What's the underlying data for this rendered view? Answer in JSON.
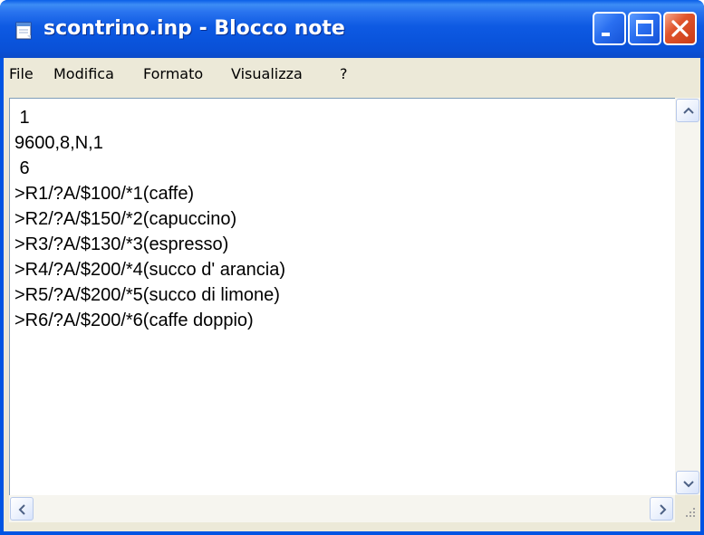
{
  "window": {
    "title": "scontrino.inp - Blocco note",
    "app_icon": "notepad-icon",
    "controls": {
      "minimize_icon": "minimize-icon",
      "maximize_icon": "maximize-icon",
      "close_icon": "close-icon"
    }
  },
  "menu": {
    "items": [
      "File",
      "Modifica",
      "Formato",
      "Visualizza",
      "?"
    ]
  },
  "document": {
    "text": " 1\n9600,8,N,1\n 6\n>R1/?A/$100/*1(caffe)\n>R2/?A/$150/*2(capuccino)\n>R3/?A/$130/*3(espresso)\n>R4/?A/$200/*4(succo d' arancia)\n>R5/?A/$200/*5(succo di limone)\n>R6/?A/$200/*6(caffe doppio)"
  },
  "scrollbars": {
    "vertical": {
      "up_icon": "arrow-up-icon",
      "down_icon": "arrow-down-icon"
    },
    "horizontal": {
      "left_icon": "arrow-left-icon",
      "right_icon": "arrow-right-icon"
    },
    "grip_icon": "resize-grip-icon"
  },
  "colors": {
    "title_bar": "#0a54dc",
    "close_button": "#e0552d",
    "chrome": "#ece9d8",
    "editor_background": "#ffffff"
  }
}
